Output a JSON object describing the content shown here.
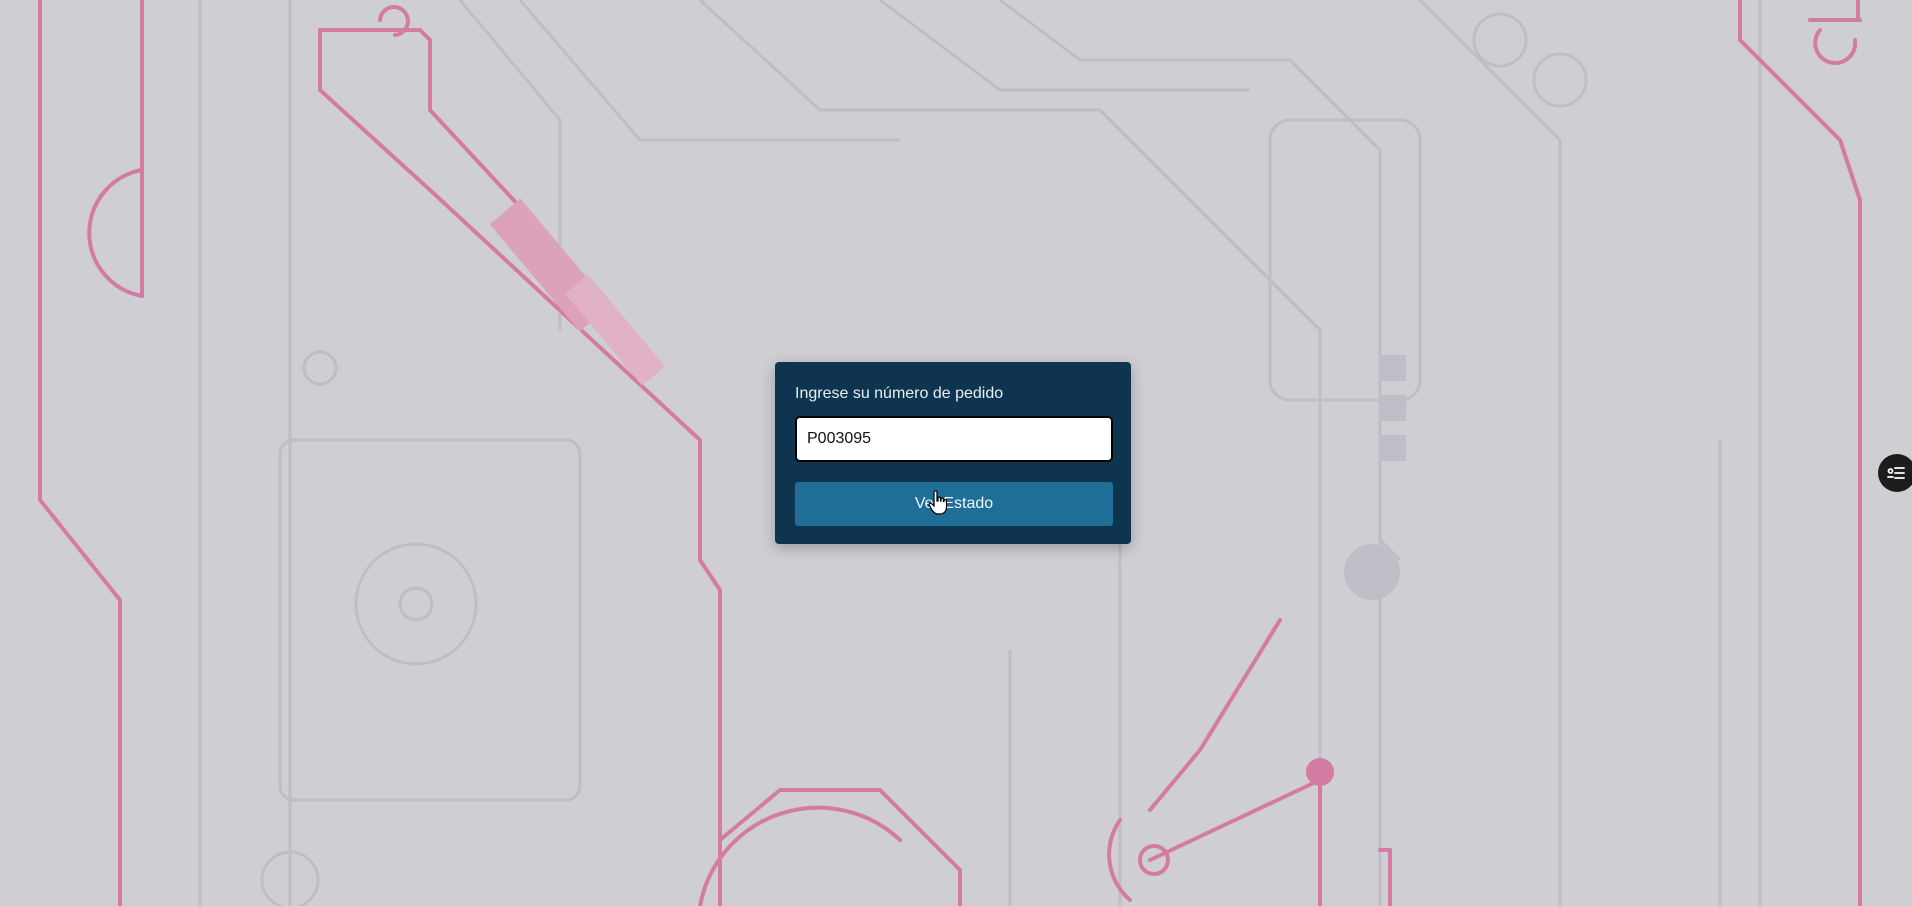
{
  "form": {
    "label": "Ingrese su número de pedido",
    "order_value": "P003095",
    "submit_label": "Ver Estado"
  },
  "side_handle": {
    "icon": "list-settings-icon"
  },
  "colors": {
    "card_bg": "#0e3450",
    "button_bg": "#1f6e98",
    "circuit_pink": "#e07aa6",
    "circuit_gray": "#c4c7cf",
    "page_bg": "#d9d9de"
  }
}
